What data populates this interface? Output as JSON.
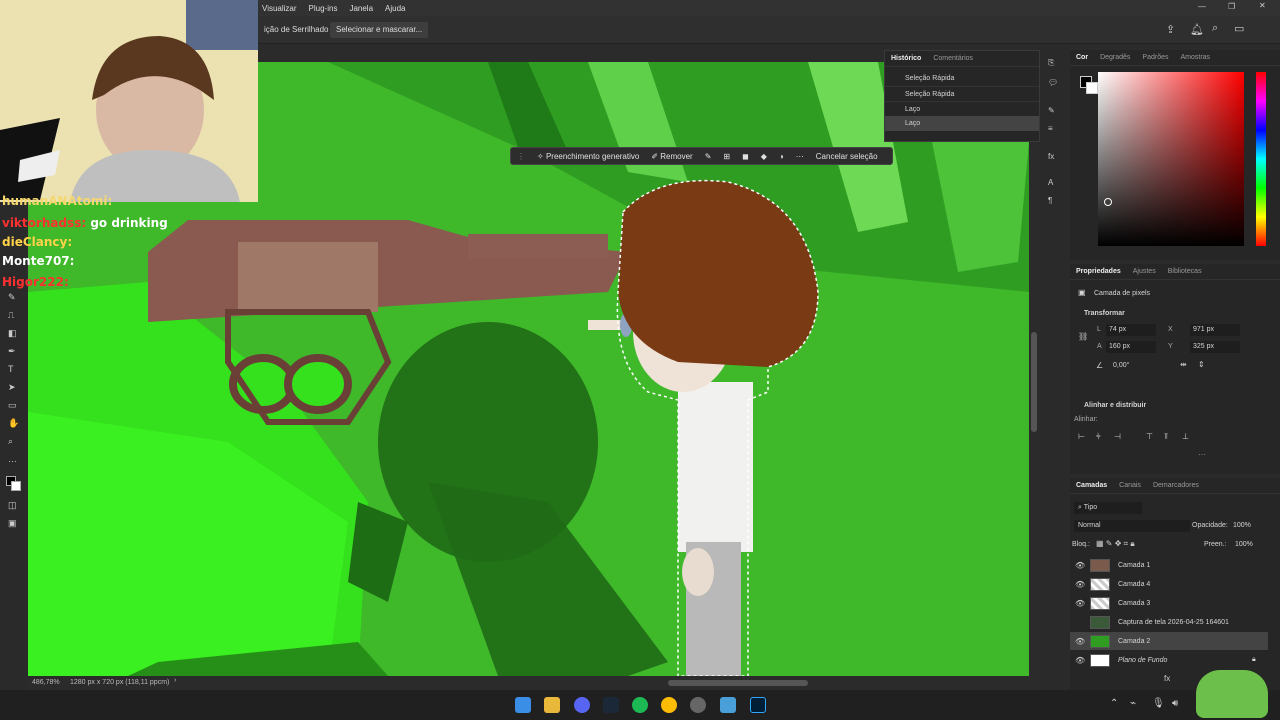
{
  "menu": {
    "items": [
      "Visualizar",
      "Plug-ins",
      "Janela",
      "Ajuda"
    ]
  },
  "options_bar": {
    "antialias_label": "ição de Serrilhado",
    "select_mask_label": "Selecionar e mascarar..."
  },
  "context_bar": {
    "generative_fill": "Preenchimento generativo",
    "remove": "Remover",
    "cancel_selection": "Cancelar seleção"
  },
  "history": {
    "tabs": [
      "Histórico",
      "Comentários"
    ],
    "items": [
      "Seleção Rápida",
      "Seleção Rápida",
      "Laço",
      "Laço"
    ]
  },
  "color_panel": {
    "tabs": [
      "Cor",
      "Degradês",
      "Padrões",
      "Amostras"
    ],
    "base_hue_color": "#ff0000"
  },
  "properties": {
    "tabs": [
      "Propriedades",
      "Ajustes",
      "Bibliotecas"
    ],
    "layer_type": "Camada de pixels",
    "transform_title": "Transformar",
    "w_label": "L",
    "w_value": "74 px",
    "h_label": "A",
    "h_value": "160 px",
    "x_label": "X",
    "x_value": "971 px",
    "y_label": "Y",
    "y_value": "325 px",
    "angle_value": "0,00°",
    "align_title": "Alinhar e distribuir",
    "align_sub": "Alinhar:"
  },
  "layers": {
    "tabs": [
      "Camadas",
      "Canais",
      "Demarcadores"
    ],
    "filter": "Tipo",
    "blend_mode": "Normal",
    "opacity_label": "Opacidade:",
    "opacity_value": "100%",
    "lock_label": "Bloq.:",
    "fill_label": "Preen.:",
    "fill_value": "100%",
    "items": [
      "Camada 1",
      "Camada 4",
      "Camada 3",
      "Captura de tela 2026-04-25 164601",
      "Camada 2",
      "Plano de Fundo"
    ]
  },
  "status": {
    "zoom": "486,78%",
    "doc_info": "1280 px x 720 px (118,11 ppcm)"
  },
  "chat": [
    {
      "user": "humanANAtomi:",
      "message": "",
      "color": "#f5d76e"
    },
    {
      "user": "viktorhadss:",
      "message": "go drinking",
      "color": "#ff3030"
    },
    {
      "user": "dieClancy:",
      "message": "",
      "color": "#ffd24a"
    },
    {
      "user": "Monte707:",
      "message": "",
      "color": "#ffffff"
    },
    {
      "user": "Higor222:",
      "message": "",
      "color": "#ff3030"
    }
  ]
}
